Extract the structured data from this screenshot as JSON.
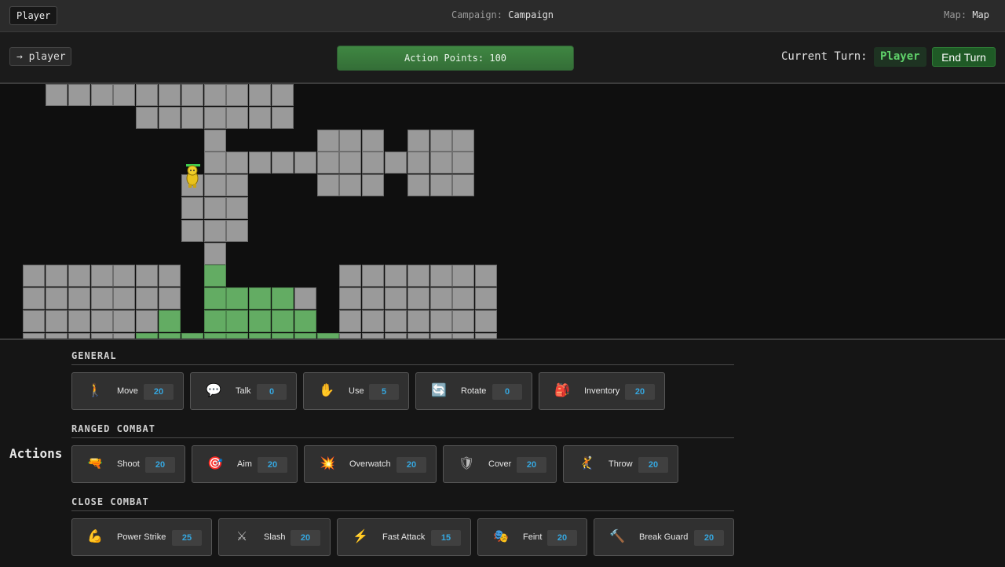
{
  "topbar": {
    "player_badge": "Player",
    "campaign_label": "Campaign:",
    "campaign_value": "Campaign",
    "map_label": "Map:",
    "map_value": "Map"
  },
  "status": {
    "selector": "→ player",
    "action_points_text": "Action Points: 100",
    "action_points_fill": 1.0,
    "current_turn_label": "Current Turn:",
    "current_turn_value": "Player",
    "end_turn_label": "End Turn"
  },
  "actions": {
    "title": "Actions",
    "sections": [
      {
        "title": "GENERAL",
        "buttons": [
          {
            "label": "Move",
            "cost": "20",
            "icon": "walk-icon"
          },
          {
            "label": "Talk",
            "cost": "0",
            "icon": "speech-bubble-icon"
          },
          {
            "label": "Use",
            "cost": "5",
            "icon": "hand-icon"
          },
          {
            "label": "Rotate",
            "cost": "0",
            "icon": "rotate-icon"
          },
          {
            "label": "Inventory",
            "cost": "20",
            "icon": "backpack-icon"
          }
        ]
      },
      {
        "title": "RANGED COMBAT",
        "buttons": [
          {
            "label": "Shoot",
            "cost": "20",
            "icon": "gun-icon"
          },
          {
            "label": "Aim",
            "cost": "20",
            "icon": "target-icon"
          },
          {
            "label": "Overwatch",
            "cost": "20",
            "icon": "burst-icon"
          },
          {
            "label": "Cover",
            "cost": "20",
            "icon": "shield-icon"
          },
          {
            "label": "Throw",
            "cost": "20",
            "icon": "throw-icon"
          }
        ]
      },
      {
        "title": "CLOSE COMBAT",
        "buttons": [
          {
            "label": "Power Strike",
            "cost": "25",
            "icon": "flexed-arm-icon"
          },
          {
            "label": "Slash",
            "cost": "20",
            "icon": "crossed-swords-icon"
          },
          {
            "label": "Fast Attack",
            "cost": "15",
            "icon": "lightning-icon"
          },
          {
            "label": "Feint",
            "cost": "20",
            "icon": "masks-icon"
          },
          {
            "label": "Break Guard",
            "cost": "20",
            "icon": "hammer-icon"
          }
        ]
      }
    ]
  },
  "colors": {
    "tile": "#9a9a9a",
    "reachable_tile": "#63ac63",
    "accent_cost": "#35a7e0",
    "turn_player": "#5fd16a"
  }
}
